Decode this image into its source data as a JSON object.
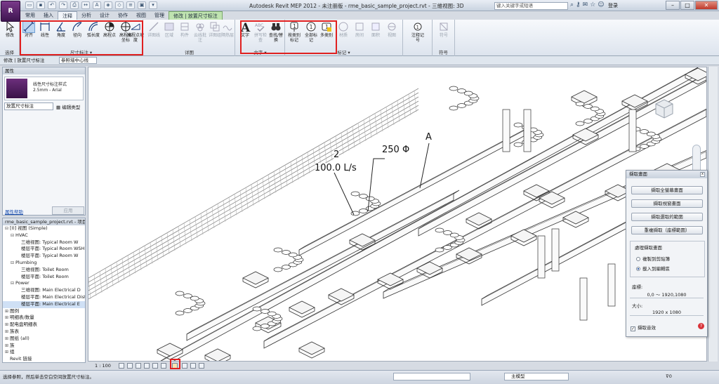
{
  "titlebar": {
    "app_button": "R",
    "title": "Autodesk Revit MEP 2012 - 未注册版 - rme_basic_sample_project.rvt - 三維视图: 3D",
    "search_placeholder": "键入关键字或短语",
    "login": "登录"
  },
  "tabs": [
    "常用",
    "插入",
    "注释",
    "分析",
    "设计",
    "协作",
    "视图",
    "管理",
    "修改 | 放置尺寸标注"
  ],
  "ribbon": {
    "panel_select": "选择",
    "panel_dimension": "尺寸标注",
    "panel_detail": "详图",
    "panel_text": "文字",
    "panel_tag": "标记",
    "panel_symbol": "符号",
    "buttons": {
      "modify": "修改",
      "aligned": "对齐",
      "linear": "线性",
      "angular": "角度",
      "radial": "径向",
      "arc_length": "弧长度",
      "spot_elevation": "高程点",
      "spot_coordinate": "高程点坐标",
      "spot_slope": "高程点坡度",
      "detail_line": "详图线",
      "region": "区域",
      "component": "构件",
      "revision_cloud": "云线批注",
      "detail_group": "详图组",
      "insulation": "隔热层",
      "text": "文字",
      "spelling": "拼写检查",
      "find_replace": "查找/替换",
      "tag_by_category": "按类别标记",
      "tag_all": "全部标记",
      "multi_category": "多类别",
      "b1": "材质",
      "b2": "房间",
      "b3": "面积",
      "b4": "视图",
      "b5": "关键",
      "legend": "注释记号",
      "symbol": "符号"
    }
  },
  "optbar": {
    "label": "修改 | 放置尺寸标注",
    "ref_select": "参照墙中心线"
  },
  "properties": {
    "header": "属性",
    "type_name_line1": "线性尺寸标注样式",
    "type_name_line2": "2.5mm - Arial",
    "instance_select": "放置尺寸标注",
    "edit_type": "编辑类型",
    "help_link": "属性帮助",
    "apply": "应用"
  },
  "browser": {
    "header": "rme_basic_sample_project.rvt - 项目浏览器",
    "rows": [
      {
        "indent": 0,
        "toggle": "⊟",
        "label": "[0] 视图 (Simple)"
      },
      {
        "indent": 1,
        "toggle": "⊟",
        "label": "HVAC"
      },
      {
        "indent": 2,
        "toggle": "",
        "label": "三维视图: Typical Room W"
      },
      {
        "indent": 2,
        "toggle": "",
        "label": "楼层平面: Typical Room WSHI"
      },
      {
        "indent": 2,
        "toggle": "",
        "label": "楼层平面: Typical Room W"
      },
      {
        "indent": 1,
        "toggle": "⊟",
        "label": "Plumbing"
      },
      {
        "indent": 2,
        "toggle": "",
        "label": "三维视图: Toilet Room"
      },
      {
        "indent": 2,
        "toggle": "",
        "label": "楼层平面: Toilet Room"
      },
      {
        "indent": 1,
        "toggle": "⊟",
        "label": "Power"
      },
      {
        "indent": 2,
        "toggle": "",
        "label": "三维视图: Main Electrical D"
      },
      {
        "indent": 2,
        "toggle": "",
        "label": "楼层平面: Main Electrical Distr"
      },
      {
        "indent": 2,
        "toggle": "",
        "label": "楼层平面: Main Electrical E",
        "selected": true
      },
      {
        "indent": 0,
        "toggle": "⊞",
        "label": "图例"
      },
      {
        "indent": 0,
        "toggle": "⊞",
        "label": "明细表/数量"
      },
      {
        "indent": 0,
        "toggle": "⊞",
        "label": "配电盘明细表"
      },
      {
        "indent": 0,
        "toggle": "⊞",
        "label": "族表"
      },
      {
        "indent": 0,
        "toggle": "⊞",
        "label": "图纸 (all)"
      },
      {
        "indent": 0,
        "toggle": "⊞",
        "label": "族"
      },
      {
        "indent": 0,
        "toggle": "⊞",
        "label": "组"
      },
      {
        "indent": 0,
        "toggle": "",
        "label": "Revit 链接"
      }
    ]
  },
  "canvas": {
    "annotation_flow_count": "2",
    "annotation_flow": "100.0 L/s",
    "annotation_diameter": "250 Φ",
    "annotation_letter": "A"
  },
  "dialog": {
    "title": "擷取畫面",
    "btn_full": "擷取全螢幕畫面",
    "btn_window": "擷取視窗畫面",
    "btn_region": "擷取選取的範圍",
    "btn_repeat": "重複擷取（座標範圍）",
    "group_label": "處理擷取畫面",
    "radio_clipboard": "複製到剪貼簿",
    "radio_paste": "載入到編輯區",
    "coord_label": "座標:",
    "coord_value": "0,0 ～ 1920,1080",
    "size_label": "大小:",
    "size_value": "1920 x 1080",
    "sound_label": "擷取音效",
    "help": "?"
  },
  "viewbar": {
    "scale": "1 : 100"
  },
  "status": {
    "message": "选择参照，然后单击空白空间放置尺寸标注。",
    "model": "主模型",
    "filter": "0"
  },
  "colors": {
    "accent_red": "#e02020",
    "contextual_tab": "#bfe3b0",
    "ribbon_bg": "#eef2f7"
  }
}
